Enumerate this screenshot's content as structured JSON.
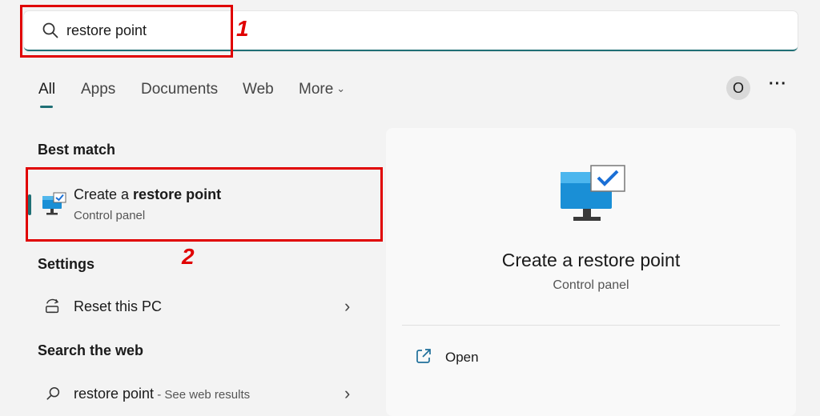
{
  "search": {
    "query": "restore point"
  },
  "callouts": {
    "one": "1",
    "two": "2"
  },
  "tabs": [
    {
      "label": "All"
    },
    {
      "label": "Apps"
    },
    {
      "label": "Documents"
    },
    {
      "label": "Web"
    },
    {
      "label": "More"
    }
  ],
  "avatar_letter": "O",
  "more_options": "···",
  "best_match": {
    "heading": "Best match",
    "title_prefix": "Create a ",
    "title_bold": "restore point",
    "subtitle": "Control panel"
  },
  "settings": {
    "heading": "Settings",
    "items": [
      {
        "label": "Reset this PC"
      }
    ]
  },
  "web": {
    "heading": "Search the web",
    "query": "restore point",
    "suffix": " - See web results"
  },
  "preview": {
    "title": "Create a restore point",
    "subtitle": "Control panel",
    "actions": [
      {
        "label": "Open"
      }
    ]
  },
  "colors": {
    "accent": "#1f6f75",
    "callout": "#e00000"
  }
}
